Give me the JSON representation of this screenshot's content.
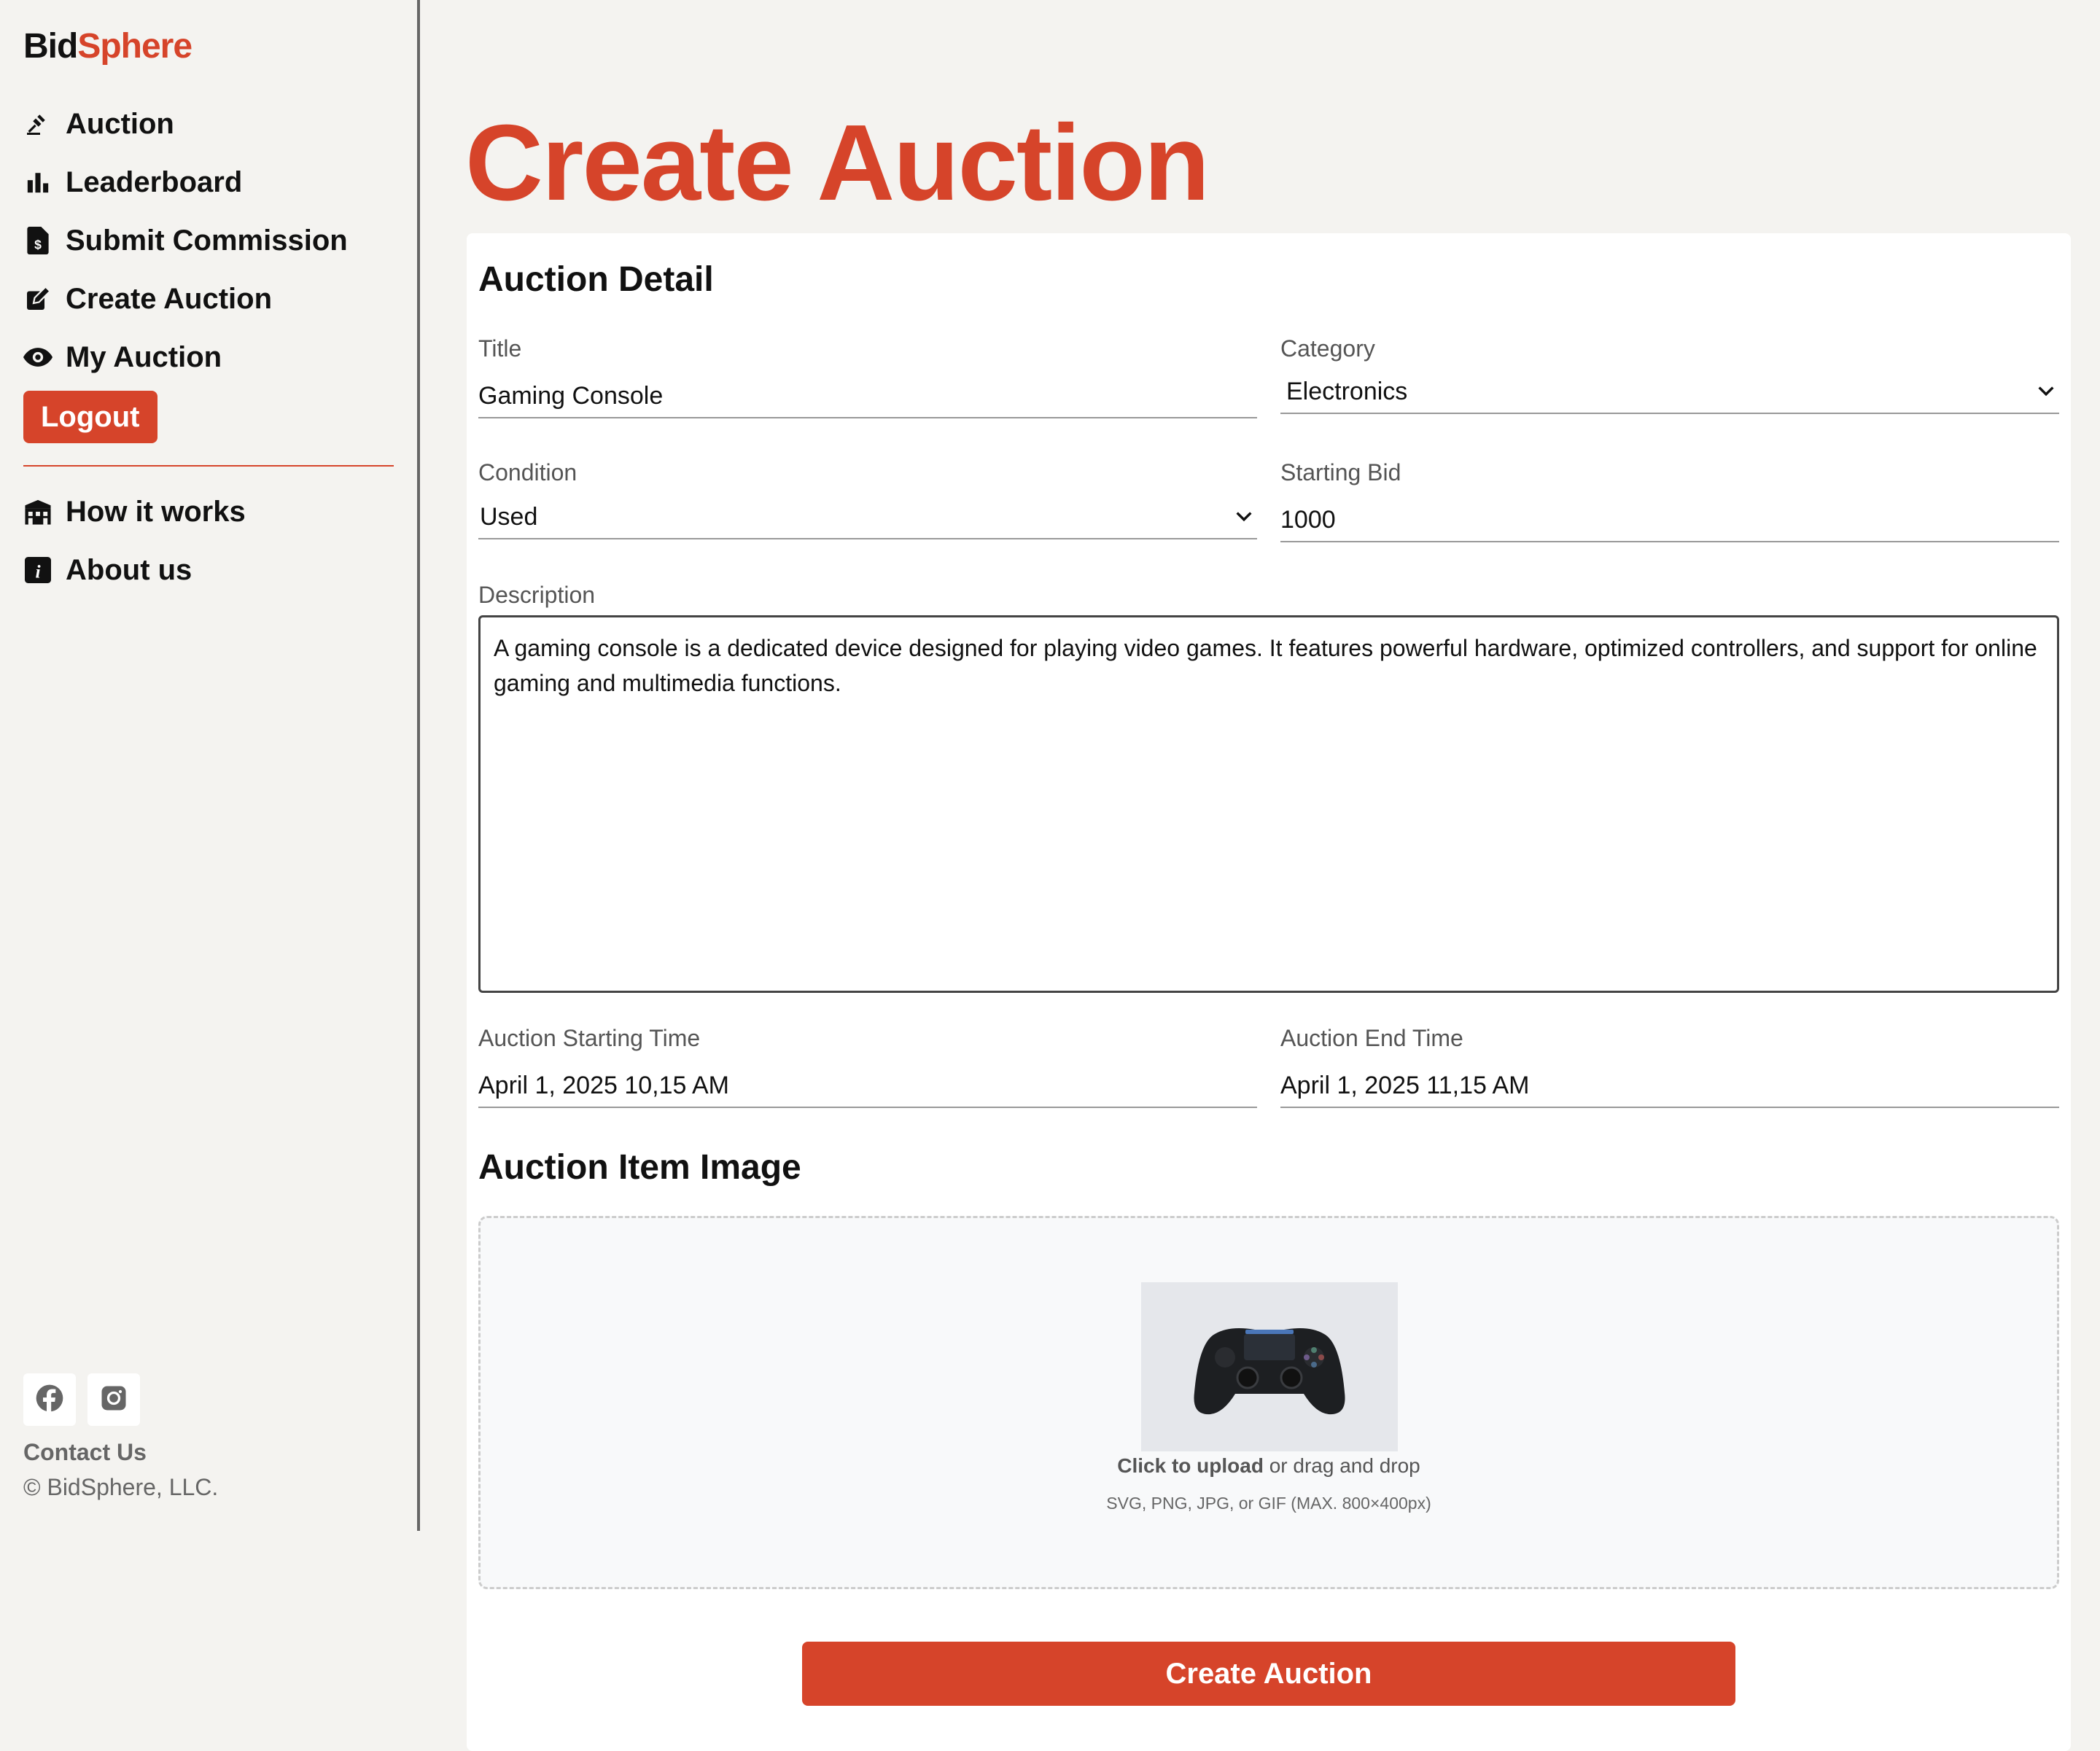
{
  "sidebar": {
    "brand_part1": "Bid",
    "brand_part2": "Sphere",
    "nav": [
      {
        "label": "Auction",
        "icon": "gavel-icon"
      },
      {
        "label": "Leaderboard",
        "icon": "bar-chart-icon"
      },
      {
        "label": "Submit Commission",
        "icon": "dollar-file-icon"
      },
      {
        "label": "Create Auction",
        "icon": "edit-icon"
      },
      {
        "label": "My Auction",
        "icon": "eye-icon"
      }
    ],
    "logout_label": "Logout",
    "nav2": [
      {
        "label": "How it works",
        "icon": "bank-icon"
      },
      {
        "label": "About us",
        "icon": "info-icon"
      }
    ],
    "socials": [
      "facebook-icon",
      "instagram-icon"
    ],
    "contact": "Contact Us",
    "copyright": "© BidSphere, LLC."
  },
  "page_title": "Create Auction",
  "form": {
    "section_detail": "Auction Detail",
    "title_label": "Title",
    "title_value": "Gaming Console",
    "category_label": "Category",
    "category_value": "Electronics",
    "condition_label": "Condition",
    "condition_value": "Used",
    "starting_bid_label": "Starting Bid",
    "starting_bid_value": "1000",
    "description_label": "Description",
    "description_value": "A gaming console is a dedicated device designed for playing video games. It features powerful hardware, optimized controllers, and support for online gaming and multimedia functions.",
    "start_time_label": "Auction Starting Time",
    "start_time_value": "April 1, 2025 10,15 AM",
    "end_time_label": "Auction End Time",
    "end_time_value": "April 1, 2025 11,15 AM",
    "section_image": "Auction Item Image",
    "upload_strong": "Click to upload",
    "upload_rest": " or drag and drop",
    "upload_hint": "SVG, PNG, JPG, or GIF (MAX. 800×400px)",
    "submit_label": "Create Auction"
  },
  "colors": {
    "accent": "#d6442a",
    "background": "#f4f3f0",
    "card": "#ffffff"
  }
}
